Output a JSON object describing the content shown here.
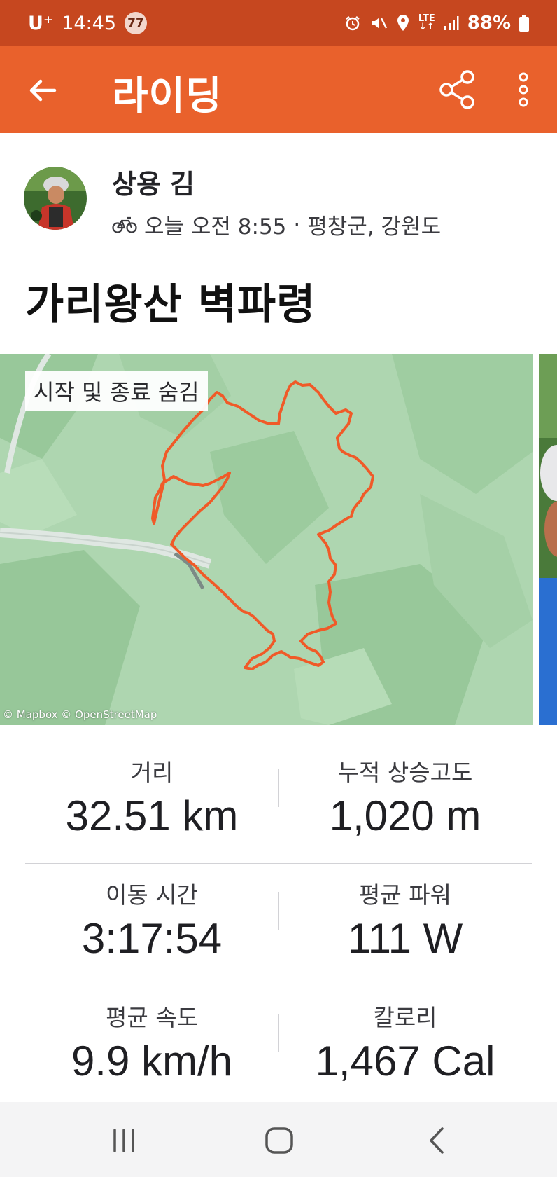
{
  "status_bar": {
    "carrier": "U⁺",
    "time": "14:45",
    "notification_count": "77",
    "network": "LTE",
    "battery": "88%"
  },
  "app_bar": {
    "title": "라이딩"
  },
  "athlete": {
    "name": "상용 김",
    "date_time": "오늘 오전 8:55",
    "separator": "·",
    "location": "평창군, 강원도"
  },
  "activity": {
    "title": "가리왕산 벽파령"
  },
  "map": {
    "hide_start_end_label": "시작 및 종료 숨김",
    "credit": "© Mapbox © OpenStreetMap",
    "route_color": "#f05a28"
  },
  "stats": [
    {
      "label": "거리",
      "value": "32.51 km"
    },
    {
      "label": "누적 상승고도",
      "value": "1,020 m"
    },
    {
      "label": "이동 시간",
      "value": "3:17:54"
    },
    {
      "label": "평균 파워",
      "value": "111 W"
    },
    {
      "label": "평균 속도",
      "value": "9.9 km/h"
    },
    {
      "label": "칼로리",
      "value": "1,467 Cal"
    }
  ],
  "colors": {
    "status_bar": "#c6471f",
    "app_bar": "#e9612c",
    "accent": "#f05a28"
  }
}
